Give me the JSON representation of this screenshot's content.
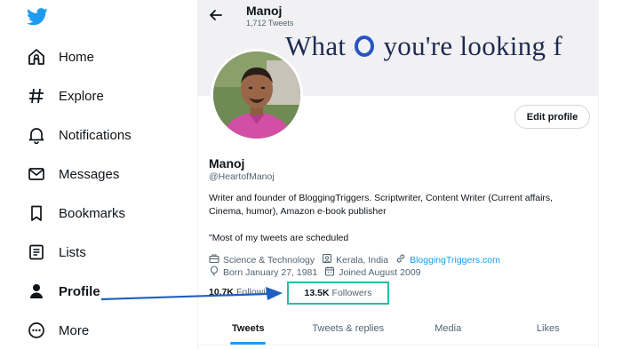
{
  "sidebar": {
    "logo_icon": "twitter-bird-icon",
    "items": [
      {
        "label": "Home",
        "icon": "home-icon"
      },
      {
        "label": "Explore",
        "icon": "hashtag-icon"
      },
      {
        "label": "Notifications",
        "icon": "bell-icon"
      },
      {
        "label": "Messages",
        "icon": "envelope-icon"
      },
      {
        "label": "Bookmarks",
        "icon": "bookmark-icon"
      },
      {
        "label": "Lists",
        "icon": "list-icon"
      },
      {
        "label": "Profile",
        "icon": "person-icon",
        "active": true
      },
      {
        "label": "More",
        "icon": "more-circle-icon"
      }
    ]
  },
  "header": {
    "name": "Manoj",
    "tweet_count": "1,712 Tweets"
  },
  "banner": {
    "text_before": "What",
    "text_after": "you're looking f"
  },
  "profile": {
    "edit_button": "Edit profile",
    "name": "Manoj",
    "handle": "@HeartofManoj",
    "bio": "Writer and founder of BloggingTriggers. Scriptwriter, Content Writer (Current affairs, Cinema, humor), Amazon e-book publisher",
    "bio_note": "\"Most of my tweets are scheduled",
    "category": "Science & Technology",
    "location": "Kerala, India",
    "website": "BloggingTriggers.com",
    "born": "Born January 27, 1981",
    "joined": "Joined August 2009",
    "following_count": "10.7K",
    "following_label": "Following",
    "followers_count": "13.5K",
    "followers_label": "Followers"
  },
  "tabs": [
    "Tweets",
    "Tweets & replies",
    "Media",
    "Likes"
  ],
  "colors": {
    "accent": "#1d9bf0",
    "highlight_box": "#2bbba2",
    "annotation_arrow": "#1f5fbf"
  }
}
